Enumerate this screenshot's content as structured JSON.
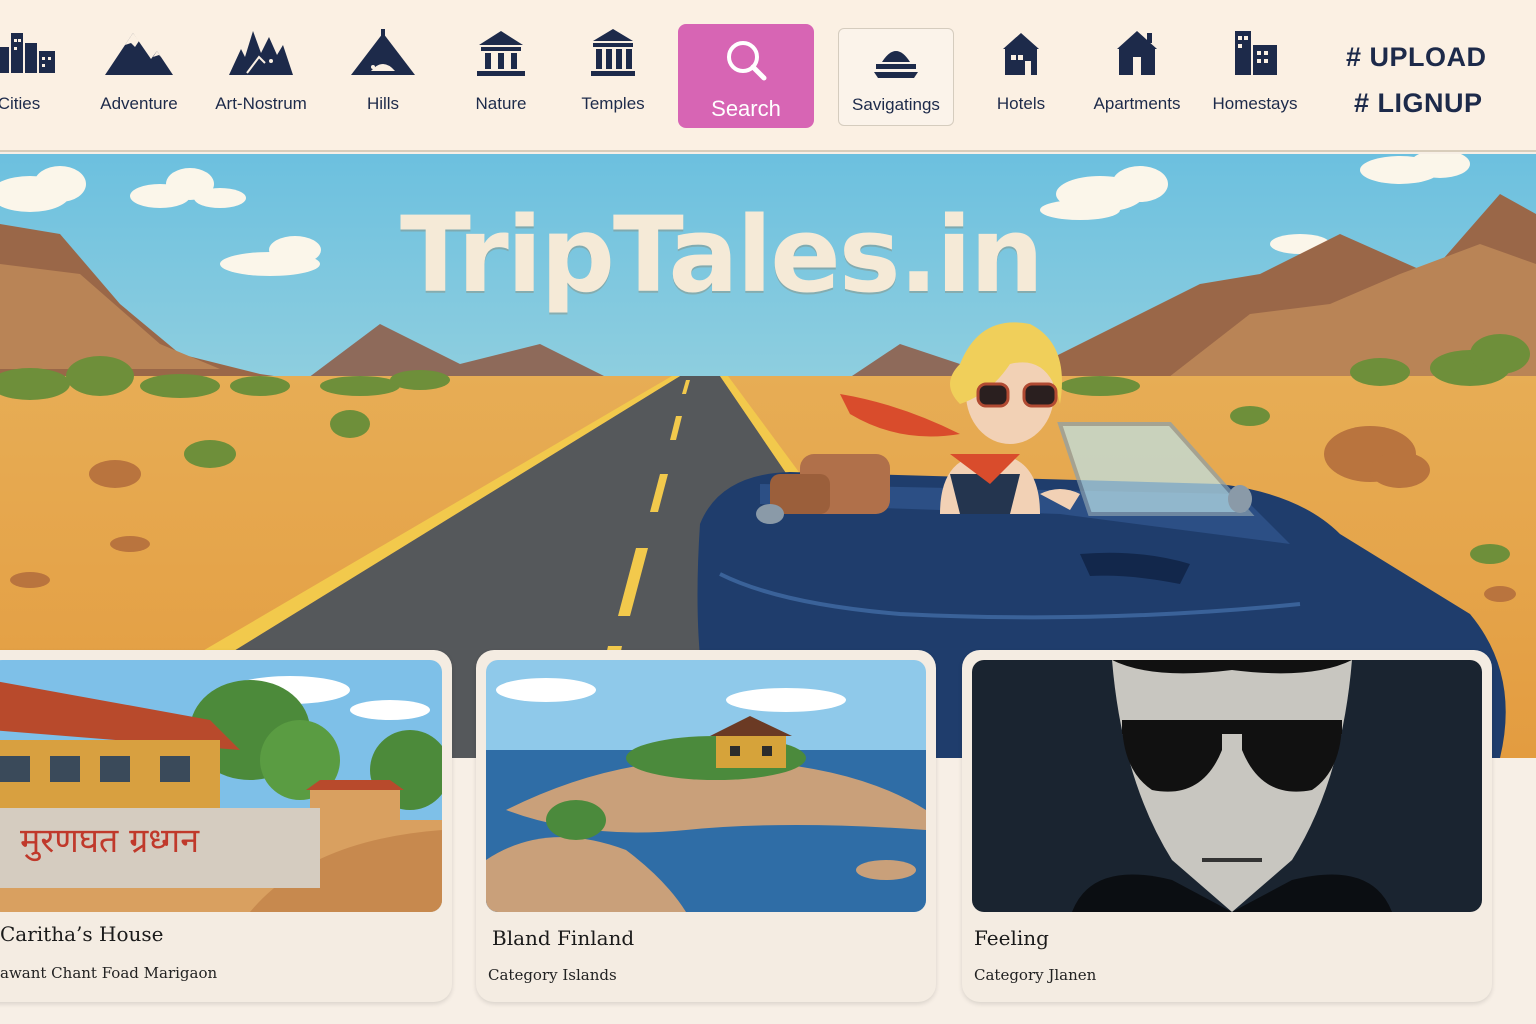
{
  "nav": {
    "items": [
      {
        "label": "Cities",
        "icon": "city-skyline-icon"
      },
      {
        "label": "Adventure",
        "icon": "mountain-icon"
      },
      {
        "label": "Art-Nostrum",
        "icon": "castle-icon"
      },
      {
        "label": "Hills",
        "icon": "hill-tent-icon"
      },
      {
        "label": "Nature",
        "icon": "pavilion-icon"
      },
      {
        "label": "Temples",
        "icon": "temple-columns-icon"
      },
      {
        "label": "Search",
        "icon": "search-icon"
      },
      {
        "label": "Savigatings",
        "icon": "boat-icon"
      },
      {
        "label": "Hotels",
        "icon": "house-icon"
      },
      {
        "label": "Apartments",
        "icon": "apartment-house-icon"
      },
      {
        "label": "Homestays",
        "icon": "building-icon"
      }
    ],
    "actions": {
      "upload": "# UPLOAD",
      "signup": "# LIGNUP"
    }
  },
  "hero": {
    "title": "TripTales.in"
  },
  "cards": [
    {
      "title": "Caritha’s House",
      "subtitle": "awant Chant Foad Marigaon",
      "sign_text": "मुरणघत ग्रध्गन"
    },
    {
      "title": "Bland Finland",
      "subtitle": "Category  Islands"
    },
    {
      "title": "Feeling",
      "subtitle": "Category Jlanen"
    }
  ],
  "colors": {
    "nav_bg": "#fbf0e3",
    "accent": "#d765b4",
    "navy": "#1d2a4a",
    "card_bg": "#f4ece2"
  }
}
